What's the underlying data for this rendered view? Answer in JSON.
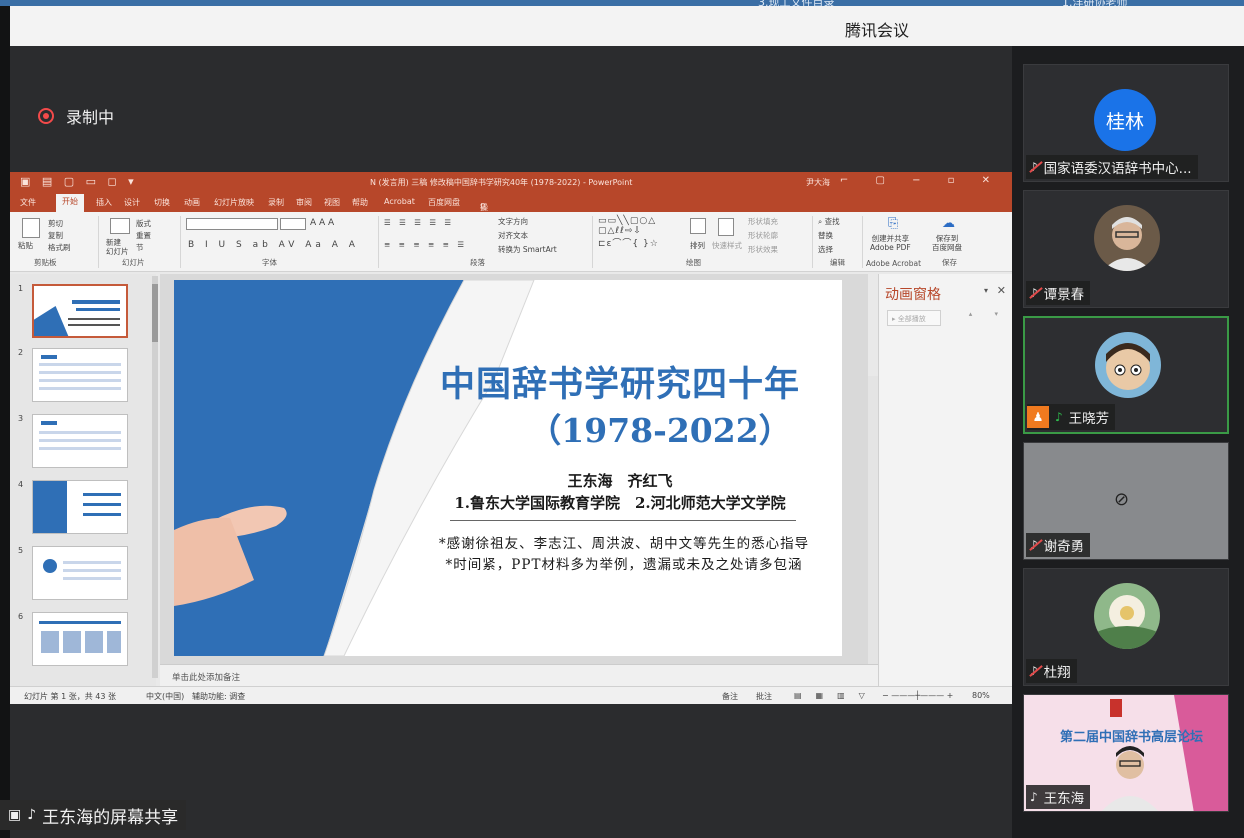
{
  "app": {
    "title": "腾讯会议",
    "top_fragments": [
      "3.现工文件目录",
      "1.洋研协老师"
    ]
  },
  "recording": {
    "label": "录制中",
    "color": "#f34a4a"
  },
  "screen_share": {
    "label": "王东海的屏幕共享"
  },
  "ppt": {
    "window_title": "N (发言用) 三稿 修改稿中国辞书学研究40年 (1978-2022) - PowerPoint",
    "user": "尹大海",
    "tabs": [
      "文件",
      "开始",
      "插入",
      "设计",
      "切换",
      "动画",
      "幻灯片放映",
      "录制",
      "审阅",
      "视图",
      "帮助",
      "Acrobat",
      "百度网盘",
      "操作说明搜索"
    ],
    "active_tab": "开始",
    "ribbon": {
      "groups": [
        "剪贴板",
        "幻灯片",
        "字体",
        "段落",
        "绘图",
        "编辑",
        "Adobe Acrobat",
        "保存"
      ],
      "paste": "粘贴",
      "cut": "剪切",
      "copy": "复制",
      "format_painter": "格式刷",
      "new_slide": "新建\n幻灯片",
      "layout": "版式",
      "reset": "重置",
      "section": "节",
      "text_direction": "文字方向",
      "align_text": "对齐文本",
      "convert_smartart": "转换为 SmartArt",
      "arrange": "排列",
      "quick_styles": "快速样式",
      "shape_fill": "形状填充",
      "shape_outline": "形状轮廓",
      "shape_effects": "形状效果",
      "find": "查找",
      "replace": "替换",
      "select": "选择",
      "create_share_pdf": "创建并共享\nAdobe PDF",
      "save_baidu": "保存到\n百度网盘"
    },
    "thumbnail_numbers": [
      "1",
      "2",
      "3",
      "4",
      "5",
      "6"
    ],
    "slide": {
      "title": "中国辞书学研究四十年",
      "years": "（1978-2022）",
      "authors": "王东海　齐红飞",
      "affiliations": "1.鲁东大学国际教育学院　2.河北师范大学文学院",
      "ack1": "*感谢徐祖友、李志江、周洪波、胡中文等先生的悉心指导",
      "ack2": "*时间紧，PPT材料多为举例，遗漏或未及之处请多包涵"
    },
    "notes_placeholder": "单击此处添加备注",
    "animation_pane": {
      "title": "动画窗格",
      "play_all": "全部播放"
    },
    "status_bar": {
      "slide_count": "幻灯片 第 1 张，共 43 张",
      "language": "中文(中国)",
      "accessibility": "辅助功能: 调查",
      "notes": "备注",
      "comments": "批注",
      "zoom": "80%"
    },
    "brand_color": "#b7472a",
    "title_color": "#2f6fb6"
  },
  "participants": [
    {
      "name": "国家语委汉语辞书中心...",
      "avatar_text": "桂林",
      "mic": "muted",
      "camera": "avatar"
    },
    {
      "name": "谭景春",
      "mic": "muted",
      "camera": "photo"
    },
    {
      "name": "王晓芳",
      "mic": "on",
      "camera": "photo",
      "host": true,
      "active": true
    },
    {
      "name": "谢奇勇",
      "mic": "muted",
      "camera": "off"
    },
    {
      "name": "杜翔",
      "mic": "muted",
      "camera": "photo"
    },
    {
      "name": "王东海",
      "mic": "on",
      "camera": "video",
      "background_text": "第二届中国辞书高层论坛"
    }
  ]
}
